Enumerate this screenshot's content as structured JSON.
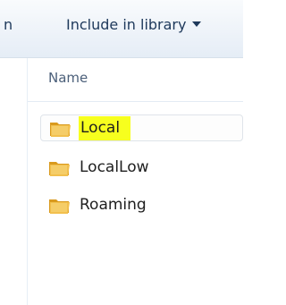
{
  "toolbar": {
    "left_fragment": "n",
    "include_label": "Include in library"
  },
  "header": {
    "name_label": "Name"
  },
  "files": [
    {
      "name": "Local",
      "icon": "folder-icon",
      "selected": true,
      "highlight": "#f7ff1e"
    },
    {
      "name": "LocalLow",
      "icon": "folder-icon",
      "selected": false
    },
    {
      "name": "Roaming",
      "icon": "folder-icon",
      "selected": false
    }
  ],
  "colors": {
    "toolbar_text": "#1e395b",
    "folder": "#e8b23a",
    "highlight": "#f7ff1e"
  }
}
